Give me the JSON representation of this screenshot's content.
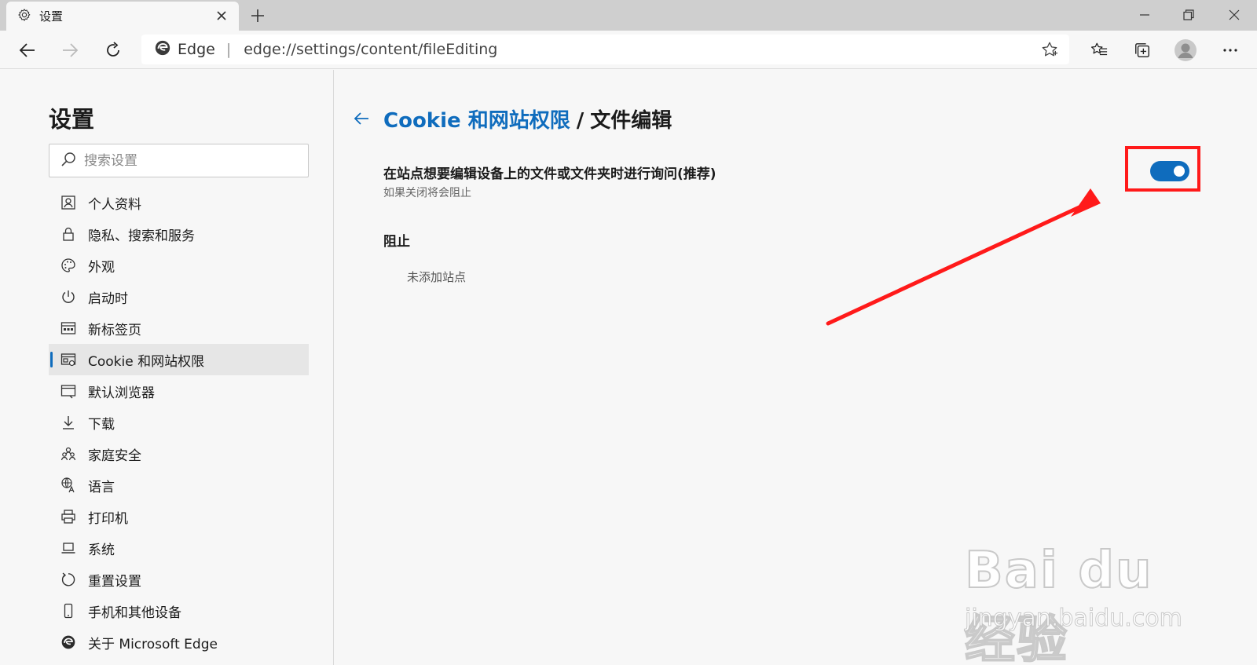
{
  "browser": {
    "tab_title": "设置",
    "address": {
      "site_name": "Edge",
      "separator": "|",
      "url": "edge://settings/content/fileEditing"
    }
  },
  "sidebar": {
    "title": "设置",
    "search_placeholder": "搜索设置",
    "items": [
      {
        "label": "个人资料",
        "icon": "profile-icon"
      },
      {
        "label": "隐私、搜索和服务",
        "icon": "lock-icon"
      },
      {
        "label": "外观",
        "icon": "palette-icon"
      },
      {
        "label": "启动时",
        "icon": "power-icon"
      },
      {
        "label": "新标签页",
        "icon": "new-tab-page-icon"
      },
      {
        "label": "Cookie 和网站权限",
        "icon": "site-permissions-icon",
        "active": true
      },
      {
        "label": "默认浏览器",
        "icon": "default-browser-icon"
      },
      {
        "label": "下载",
        "icon": "download-icon"
      },
      {
        "label": "家庭安全",
        "icon": "family-icon"
      },
      {
        "label": "语言",
        "icon": "language-icon"
      },
      {
        "label": "打印机",
        "icon": "printer-icon"
      },
      {
        "label": "系统",
        "icon": "laptop-icon"
      },
      {
        "label": "重置设置",
        "icon": "reset-icon"
      },
      {
        "label": "手机和其他设备",
        "icon": "phone-icon"
      },
      {
        "label": "关于 Microsoft Edge",
        "icon": "edge-logo-icon"
      }
    ]
  },
  "main": {
    "breadcrumb_link": "Cookie 和网站权限",
    "breadcrumb_sep": "/",
    "breadcrumb_current": "文件编辑",
    "setting_title": "在站点想要编辑设备上的文件或文件夹时进行询问(推荐)",
    "setting_desc": "如果关闭将会阻止",
    "toggle_on": true,
    "block_title": "阻止",
    "block_empty": "未添加站点"
  },
  "watermark": {
    "logo": "Bai du 经验",
    "url": "jingyan.baidu.com"
  },
  "colors": {
    "accent": "#0f6cbd",
    "annotation_red": "#ff1a1a",
    "background": "#f7f7f7"
  }
}
